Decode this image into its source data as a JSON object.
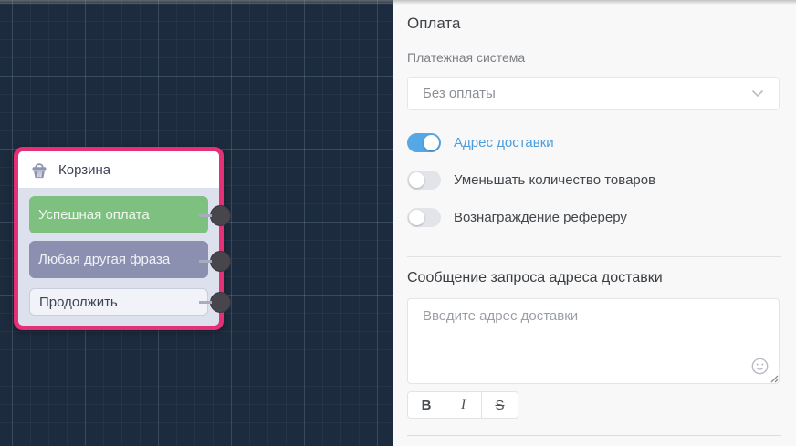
{
  "canvas": {
    "background_color": "#1d2b3e",
    "node": {
      "title": "Корзина",
      "icon": "basket-icon",
      "border_color": "#e43077",
      "outputs": [
        {
          "label": "Успешная оплата",
          "color": "#7ec07f",
          "has_connector": true
        },
        {
          "label": "Любая другая фраза",
          "color": "#8b90b1",
          "has_connector": true
        },
        {
          "label": "Продолжить",
          "color": "#f1f3f8",
          "has_connector": true
        }
      ]
    }
  },
  "panel": {
    "title": "Оплата",
    "payment_system": {
      "label": "Платежная система",
      "selected_value": "Без оплаты",
      "chevron_icon": "chevron-down-icon"
    },
    "toggles": [
      {
        "label": "Адрес доставки",
        "on": true,
        "label_color": "#4d9cda"
      },
      {
        "label": "Уменьшать количество товаров",
        "on": false
      },
      {
        "label": "Вознаграждение рефереру",
        "on": false
      }
    ],
    "message_section": {
      "heading": "Сообщение запроса адреса доставки",
      "textarea_value": "",
      "textarea_placeholder": "Введите адрес доставки",
      "emoji_icon": "smiley-icon",
      "toolbar": [
        {
          "label": "B",
          "name": "bold-button"
        },
        {
          "label": "I",
          "name": "italic-button"
        },
        {
          "label": "S",
          "name": "strikethrough-button"
        }
      ]
    },
    "accent_blue": "#56a7e6"
  }
}
